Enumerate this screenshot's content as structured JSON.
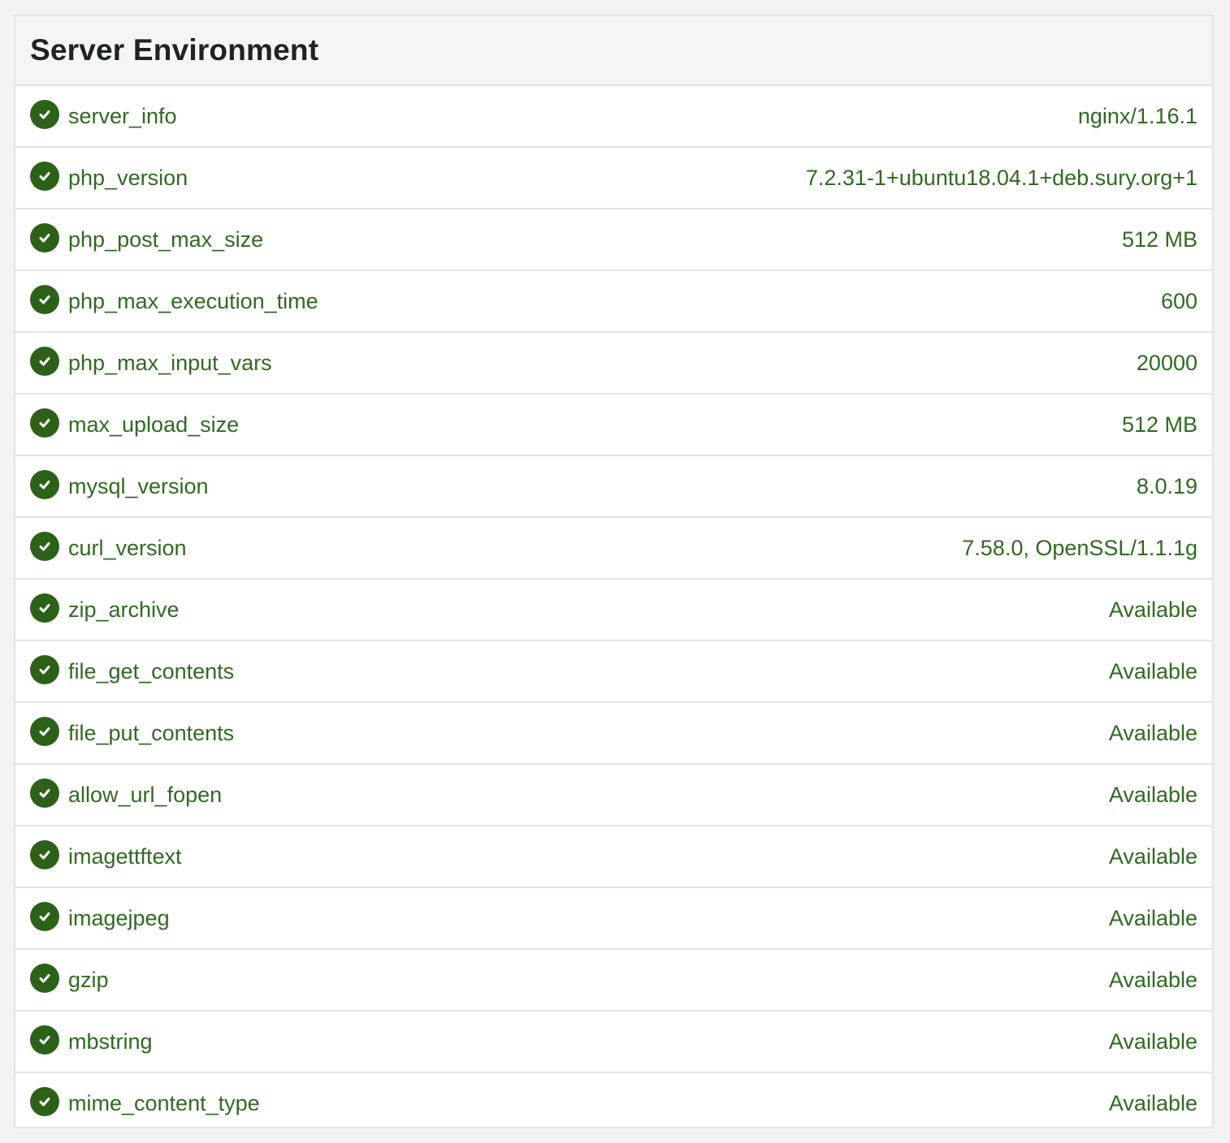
{
  "panel": {
    "title": "Server Environment",
    "status_icon": "check-circle-icon",
    "status_color": "#2c6118",
    "text_color": "#2e6b1f",
    "rows": [
      {
        "label": "server_info",
        "value": "nginx/1.16.1"
      },
      {
        "label": "php_version",
        "value": "7.2.31-1+ubuntu18.04.1+deb.sury.org+1"
      },
      {
        "label": "php_post_max_size",
        "value": "512 MB"
      },
      {
        "label": "php_max_execution_time",
        "value": "600"
      },
      {
        "label": "php_max_input_vars",
        "value": "20000"
      },
      {
        "label": "max_upload_size",
        "value": "512 MB"
      },
      {
        "label": "mysql_version",
        "value": "8.0.19"
      },
      {
        "label": "curl_version",
        "value": "7.58.0, OpenSSL/1.1.1g"
      },
      {
        "label": "zip_archive",
        "value": "Available"
      },
      {
        "label": "file_get_contents",
        "value": "Available"
      },
      {
        "label": "file_put_contents",
        "value": "Available"
      },
      {
        "label": "allow_url_fopen",
        "value": "Available"
      },
      {
        "label": "imagettftext",
        "value": "Available"
      },
      {
        "label": "imagejpeg",
        "value": "Available"
      },
      {
        "label": "gzip",
        "value": "Available"
      },
      {
        "label": "mbstring",
        "value": "Available"
      },
      {
        "label": "mime_content_type",
        "value": "Available"
      }
    ]
  }
}
